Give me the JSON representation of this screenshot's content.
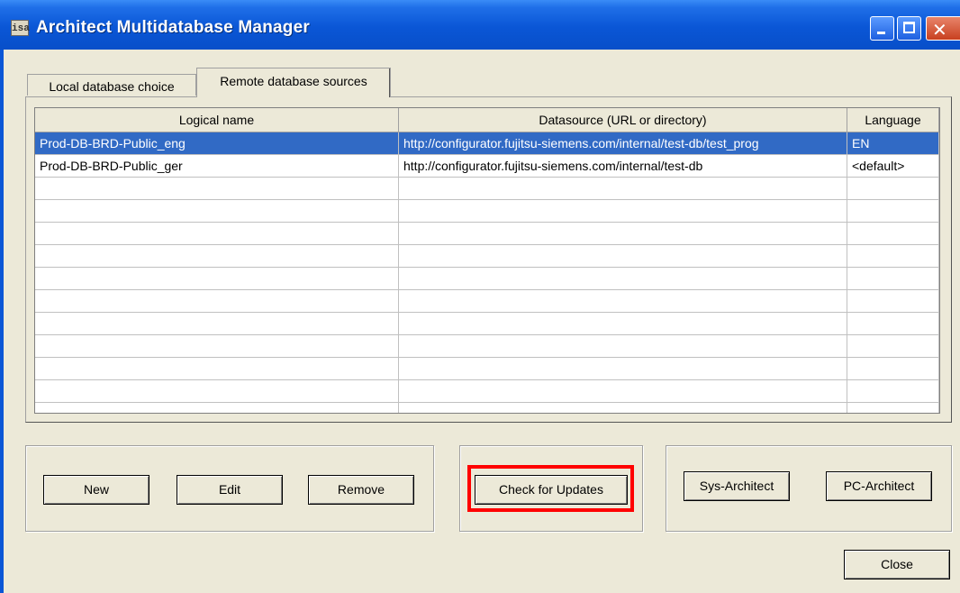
{
  "window": {
    "title": "Architect Multidatabase Manager",
    "icon_label": "isa"
  },
  "caption_buttons": {
    "minimize": "minimize-icon",
    "maximize": "maximize-icon",
    "close": "close-icon"
  },
  "tabs": [
    {
      "label": "Local database choice",
      "selected": false
    },
    {
      "label": "Remote database sources",
      "selected": true
    }
  ],
  "table": {
    "columns": [
      "Logical name",
      "Datasource (URL or directory)",
      "Language"
    ],
    "rows": [
      {
        "name": "Prod-DB-BRD-Public_eng",
        "source": "http://configurator.fujitsu-siemens.com/internal/test-db/test_prog",
        "language": "EN",
        "selected": true
      },
      {
        "name": "Prod-DB-BRD-Public_ger",
        "source": "http://configurator.fujitsu-siemens.com/internal/test-db",
        "language": "<default>",
        "selected": false
      }
    ]
  },
  "buttons": {
    "new": "New",
    "edit": "Edit",
    "remove": "Remove",
    "check_updates": "Check for Updates",
    "sys_architect": "Sys-Architect",
    "pc_architect": "PC-Architect",
    "close": "Close"
  },
  "colors": {
    "selection": "#316ac5",
    "highlight_box": "#ff0000",
    "titlebar": "#0a56d6"
  }
}
